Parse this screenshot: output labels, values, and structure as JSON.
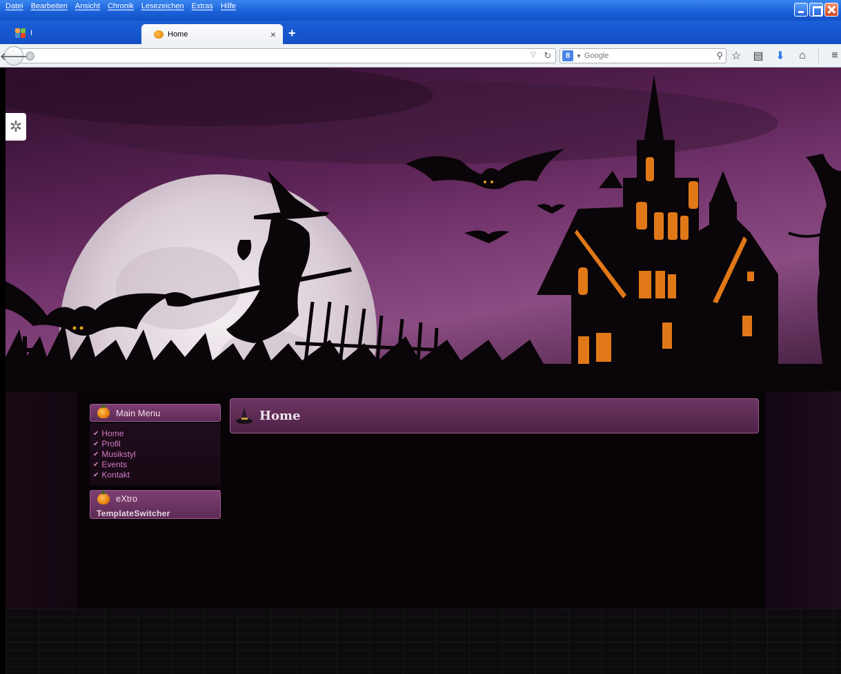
{
  "menubar": {
    "items": [
      "Datei",
      "Bearbeiten",
      "Ansicht",
      "Chronik",
      "Lesezeichen",
      "Extras",
      "Hilfe"
    ]
  },
  "tabs": {
    "inactive_label": "I",
    "active_label": "Home",
    "close_glyph": "×",
    "new_tab_glyph": "+"
  },
  "navbar": {
    "url": "",
    "search_placeholder": "Google"
  },
  "sidebar": {
    "main_menu_title": "Main Menu",
    "menu_items": [
      "Home",
      "Profil",
      "Musikstyl",
      "Events",
      "Kontakt"
    ],
    "switcher_title": "eXtro",
    "switcher_subtitle": "TemplateSwitcher"
  },
  "article": {
    "title": "Home"
  },
  "colors": {
    "menu_link": "#d77ac6",
    "header_purple": "#6b3561",
    "window_blue": "#1a5fd8",
    "window_light_orange": "#f08a1a"
  }
}
